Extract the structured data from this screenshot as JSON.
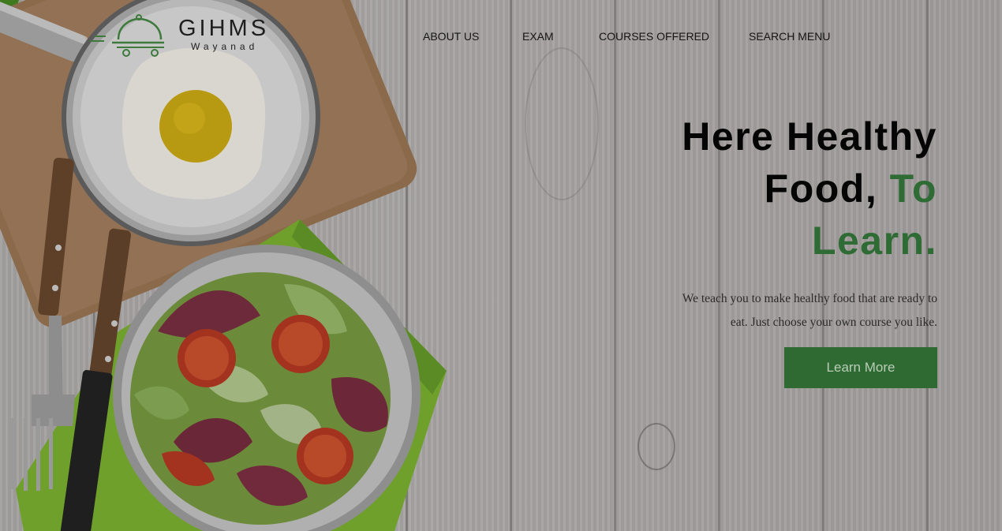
{
  "brand": {
    "name": "GIHMS",
    "location": "Wayanad",
    "accent_color": "#2f6b34",
    "icon": "cloche-cart-icon"
  },
  "nav": {
    "items": [
      {
        "label": "ABOUT US"
      },
      {
        "label": "EXAM"
      },
      {
        "label": "COURSES OFFERED"
      },
      {
        "label": "SEARCH MENU"
      }
    ]
  },
  "hero": {
    "title_line1": "Here Healthy",
    "title_line2": "Food,",
    "title_accent_1": "To",
    "title_accent_2": "Learn.",
    "description_line1": "We teach you to make healthy food that are ready to",
    "description_line2": "eat. Just choose your own course you like.",
    "cta_label": "Learn More",
    "cta_color": "#2f6a32"
  }
}
